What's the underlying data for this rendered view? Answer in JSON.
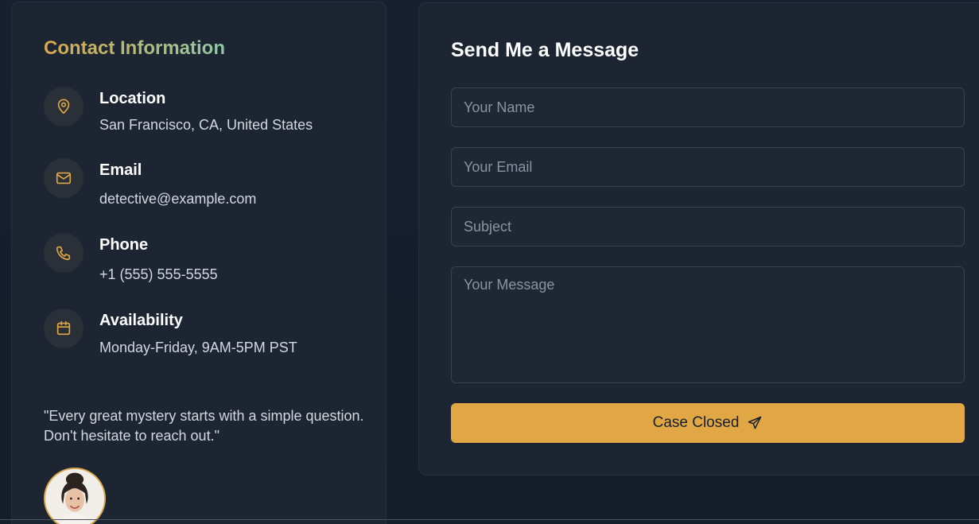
{
  "contact": {
    "title": "Contact Information",
    "items": [
      {
        "label": "Location",
        "value": "San Francisco, CA, United States",
        "icon": "map-pin-icon"
      },
      {
        "label": "Email",
        "value": "detective@example.com",
        "icon": "mail-icon"
      },
      {
        "label": "Phone",
        "value": "+1 (555) 555-5555",
        "icon": "phone-icon"
      },
      {
        "label": "Availability",
        "value": "Monday-Friday, 9AM-5PM PST",
        "icon": "calendar-icon"
      }
    ],
    "quote": "\"Every great mystery starts with a simple question. Don't hesitate to reach out.\""
  },
  "form": {
    "title": "Send Me a Message",
    "name_placeholder": "Your Name",
    "email_placeholder": "Your Email",
    "subject_placeholder": "Subject",
    "message_placeholder": "Your Message",
    "submit_label": "Case Closed",
    "submit_icon": "send-icon"
  },
  "colors": {
    "accent": "#e1a744",
    "card_bg": "#1d2533",
    "page_bg": "#151d2a",
    "title_gradient_start": "#d9a84a",
    "title_gradient_end": "#8fc9a6"
  }
}
